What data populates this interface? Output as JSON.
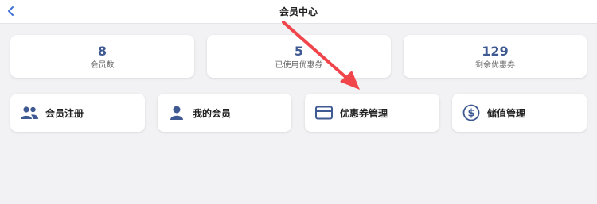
{
  "header": {
    "title": "会员中心",
    "back_icon": "chevron-left-icon"
  },
  "stats": [
    {
      "value": "8",
      "label": "会员数"
    },
    {
      "value": "5",
      "label": "已使用优惠券"
    },
    {
      "value": "129",
      "label": "剩余优惠券"
    }
  ],
  "actions": [
    {
      "label": "会员注册",
      "icon": "people-icon"
    },
    {
      "label": "我的会员",
      "icon": "person-icon"
    },
    {
      "label": "优惠券管理",
      "icon": "credit-card-icon"
    },
    {
      "label": "储值管理",
      "icon": "dollar-circle-icon"
    }
  ],
  "colors": {
    "accent": "#3f5a92",
    "annotation_arrow": "#f0464b",
    "background": "#f2f2f4"
  }
}
